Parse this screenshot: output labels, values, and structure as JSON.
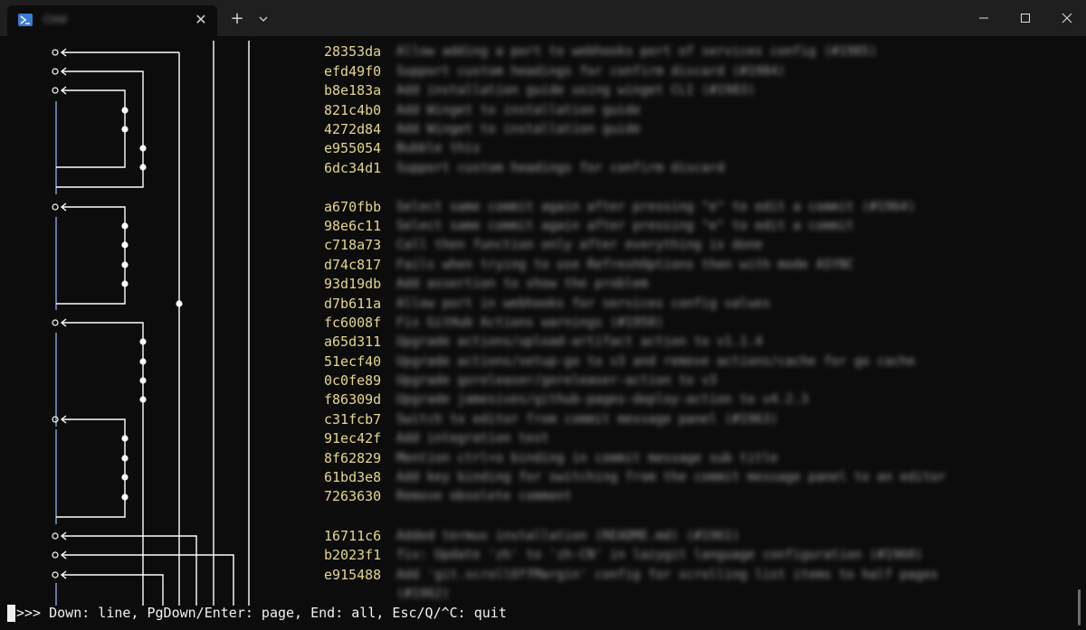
{
  "window": {
    "tab_title": "Cmd",
    "tab_close": "✕",
    "new_tab": "+",
    "icons": {
      "tab": "powershell-icon",
      "dropdown": "chevron-down-icon",
      "minimize": "minimize-icon",
      "maximize": "maximize-icon",
      "close": "close-icon"
    }
  },
  "commits": [
    {
      "hash": "28353da",
      "message": "Allow adding a port to webhooks port of services config (#1985)"
    },
    {
      "hash": "efd49f0",
      "message": "Support custom headings for confirm discard (#1984)"
    },
    {
      "hash": "b8e183a",
      "message": "Add installation guide using winget CLI (#1983)"
    },
    {
      "hash": "821c4b0",
      "message": "Add Winget to installation guide"
    },
    {
      "hash": "4272d84",
      "message": "Add Winget to installation guide"
    },
    {
      "hash": "e955054",
      "message": "Bubble this"
    },
    {
      "hash": "6dc34d1",
      "message": "Support custom headings for confirm discard"
    },
    {
      "hash": "a670fbb",
      "message": "Select same commit again after pressing \"e\" to edit a commit (#1964)"
    },
    {
      "hash": "98e6c11",
      "message": "Select same commit again after pressing \"e\" to edit a commit"
    },
    {
      "hash": "c718a73",
      "message": "Call then function only after everything is done"
    },
    {
      "hash": "d74c817",
      "message": "Fails when trying to use RefreshOptions then with mode ASYNC"
    },
    {
      "hash": "93d19db",
      "message": "Add assertion to show the problem"
    },
    {
      "hash": "d7b611a",
      "message": "Allow port in webhooks for services config values"
    },
    {
      "hash": "fc6008f",
      "message": "Fix GitHub Actions warnings (#1950)"
    },
    {
      "hash": "a65d311",
      "message": "Upgrade actions/upload-artifact action to v1.1.4"
    },
    {
      "hash": "51ecf40",
      "message": "Upgrade actions/setup-go to v3 and remove actions/cache for go cache"
    },
    {
      "hash": "0c0fe89",
      "message": "Upgrade goreleaser/goreleaser-action to v3"
    },
    {
      "hash": "f86309d",
      "message": "Upgrade jamesives/github-pages-deploy-action to v4.2.3"
    },
    {
      "hash": "c31fcb7",
      "message": "Switch to editor from commit message panel (#1963)"
    },
    {
      "hash": "91ec42f",
      "message": "Add integration test"
    },
    {
      "hash": "8f62829",
      "message": "Mention ctrl+o binding in commit message sub title"
    },
    {
      "hash": "61bd3e8",
      "message": "Add key binding for switching from the commit message panel to an editor"
    },
    {
      "hash": "7263630",
      "message": "Remove obsolete comment"
    },
    {
      "hash": "16711c6",
      "message": "Added termux installation (README.md) (#1961)"
    },
    {
      "hash": "b2023f1",
      "message": "fix: Update 'zh' to 'zh-CN' in lazygit language configuration (#1960)"
    },
    {
      "hash": "e915488",
      "message": "Add 'git.scrollOffMargin' config for scrolling list items to half pages"
    },
    {
      "hash": "",
      "message": "(#1962)"
    }
  ],
  "prompt": {
    "text": ">>> Down: line, PgDown/Enter: page, End: all, Esc/Q/^C: quit"
  },
  "colors": {
    "hash": "#e5d68a",
    "graph_line": "#ffffff",
    "left_line": "#8aa4e0"
  }
}
